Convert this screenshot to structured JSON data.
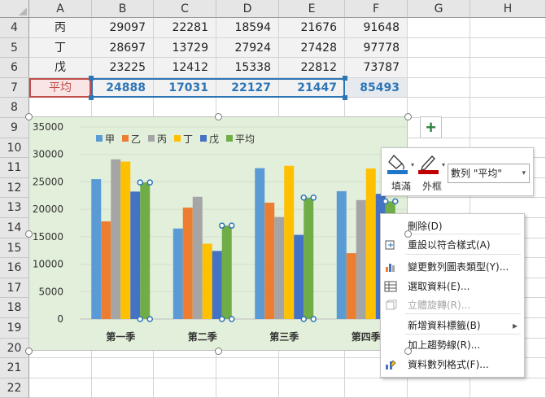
{
  "columns": [
    "A",
    "B",
    "C",
    "D",
    "E",
    "F",
    "G",
    "H"
  ],
  "rows": [
    "4",
    "5",
    "6",
    "7",
    "8",
    "9",
    "10",
    "11",
    "12",
    "13",
    "14",
    "15",
    "16",
    "17",
    "18",
    "19",
    "20",
    "21",
    "22"
  ],
  "table": [
    {
      "label": "丙",
      "values": [
        "29097",
        "22281",
        "18594",
        "21676",
        "91648"
      ]
    },
    {
      "label": "丁",
      "values": [
        "28697",
        "13729",
        "27924",
        "27428",
        "97778"
      ]
    },
    {
      "label": "戊",
      "values": [
        "23225",
        "12412",
        "15338",
        "22812",
        "73787"
      ]
    },
    {
      "label": "平均",
      "values": [
        "24888",
        "17031",
        "22127",
        "21447",
        "85493"
      ]
    }
  ],
  "colors": {
    "selection_blue": "#2e75b6",
    "selection_red": "#c0504d",
    "chart_bg": "#e2efda",
    "series": [
      "#5b9bd5",
      "#ed7d31",
      "#a5a5a5",
      "#ffc000",
      "#4472c4",
      "#70ad47"
    ]
  },
  "chart_data": {
    "type": "bar",
    "categories": [
      "第一季",
      "第二季",
      "第三季",
      "第四季"
    ],
    "series": [
      {
        "name": "甲",
        "values": [
          25500,
          16500,
          27500,
          23300
        ]
      },
      {
        "name": "乙",
        "values": [
          17800,
          20300,
          21200,
          12000
        ]
      },
      {
        "name": "丙",
        "values": [
          29097,
          22281,
          18594,
          21676
        ]
      },
      {
        "name": "丁",
        "values": [
          28697,
          13729,
          27924,
          27428
        ]
      },
      {
        "name": "戊",
        "values": [
          23225,
          12412,
          15338,
          22812
        ]
      },
      {
        "name": "平均",
        "values": [
          24888,
          17031,
          22127,
          21447
        ]
      }
    ],
    "yticks": [
      "0",
      "5000",
      "10000",
      "15000",
      "20000",
      "25000",
      "30000",
      "35000"
    ],
    "ylim": [
      0,
      35000
    ],
    "legend_position": "top-left",
    "grid": true,
    "selected_series": "平均"
  },
  "plus_button": {
    "symbol": "+"
  },
  "minibar": {
    "fill_label": "填滿",
    "outline_label": "外框",
    "series_value": "數列 \"平均\"",
    "dropdown_icon": "▾"
  },
  "context_menu": {
    "items": [
      {
        "label": "刪除(D)",
        "icon": "none",
        "disabled": false
      },
      {
        "label": "重設以符合樣式(A)",
        "icon": "reset-style-icon",
        "disabled": false
      },
      {
        "label": "變更數列圖表類型(Y)...",
        "icon": "chart-type-icon",
        "disabled": false
      },
      {
        "label": "選取資料(E)...",
        "icon": "select-data-icon",
        "disabled": false
      },
      {
        "label": "立體旋轉(R)...",
        "icon": "3d-rotate-icon",
        "disabled": true
      },
      {
        "label": "新增資料標籤(B)",
        "icon": "none",
        "disabled": false,
        "submenu": "▸"
      },
      {
        "label": "加上趨勢線(R)...",
        "icon": "none",
        "disabled": false
      },
      {
        "label": "資料數列格式(F)...",
        "icon": "format-series-icon",
        "disabled": false
      }
    ]
  }
}
